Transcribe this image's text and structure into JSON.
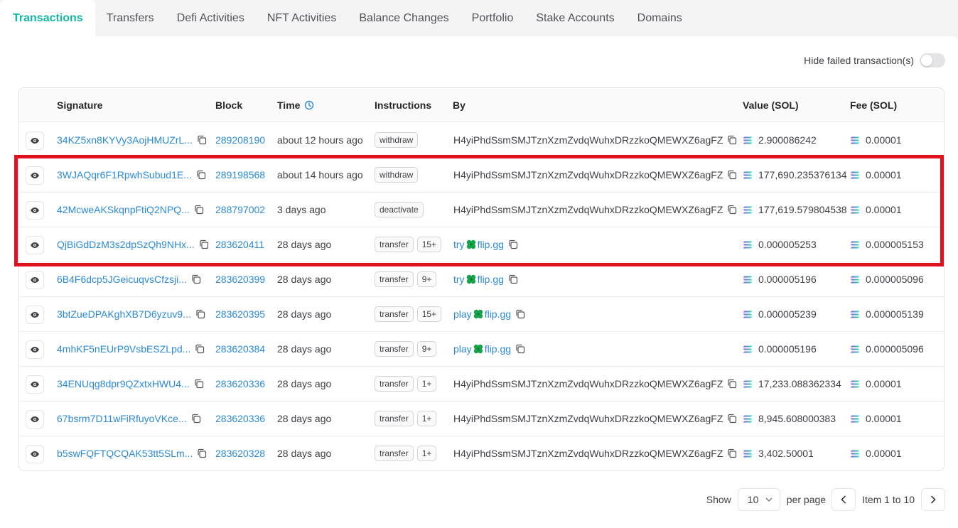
{
  "tabs": [
    {
      "label": "Transactions",
      "active": true
    },
    {
      "label": "Transfers"
    },
    {
      "label": "Defi Activities"
    },
    {
      "label": "NFT Activities"
    },
    {
      "label": "Balance Changes"
    },
    {
      "label": "Portfolio"
    },
    {
      "label": "Stake Accounts"
    },
    {
      "label": "Domains"
    }
  ],
  "toggle": {
    "label": "Hide failed transaction(s)",
    "on": false
  },
  "columns": {
    "signature": "Signature",
    "block": "Block",
    "time": "Time",
    "instructions": "Instructions",
    "by": "By",
    "value": "Value (SOL)",
    "fee": "Fee (SOL)"
  },
  "rows": [
    {
      "signature": "34KZ5xn8KYVy3AojHMUZrL...",
      "block": "289208190",
      "time": "about 12 hours ago",
      "instruction": "withdraw",
      "count": "",
      "by": "H4yiPhdSsmSMJTznXzmZvdqWuhxDRzzkoQMEWXZ6agFZ",
      "by_type": "address",
      "value": "2.900086242",
      "fee": "0.00001"
    },
    {
      "signature": "3WJAQqr6F1RpwhSubud1E...",
      "block": "289198568",
      "time": "about 14 hours ago",
      "instruction": "withdraw",
      "count": "",
      "by": "H4yiPhdSsmSMJTznXzmZvdqWuhxDRzzkoQMEWXZ6agFZ",
      "by_type": "address",
      "value": "177,690.235376134",
      "fee": "0.00001"
    },
    {
      "signature": "42McweAKSkqnpFtiQ2NPQ...",
      "block": "288797002",
      "time": "3 days ago",
      "instruction": "deactivate",
      "count": "",
      "by": "H4yiPhdSsmSMJTznXzmZvdqWuhxDRzzkoQMEWXZ6agFZ",
      "by_type": "address",
      "value": "177,619.579804538",
      "fee": "0.00001"
    },
    {
      "signature": "QjBiGdDzM3s2dpSzQh9NHx...",
      "block": "283620411",
      "time": "28 days ago",
      "instruction": "transfer",
      "count": "15+",
      "by_prefix": "try",
      "by_suffix": "flip.gg",
      "by_type": "domain",
      "value": "0.000005253",
      "fee": "0.000005153"
    },
    {
      "signature": "6B4F6dcp5JGeicuqvsCfzsji...",
      "block": "283620399",
      "time": "28 days ago",
      "instruction": "transfer",
      "count": "9+",
      "by_prefix": "try",
      "by_suffix": "flip.gg",
      "by_type": "domain",
      "value": "0.000005196",
      "fee": "0.000005096"
    },
    {
      "signature": "3btZueDPAKghXB7D6yzuv9...",
      "block": "283620395",
      "time": "28 days ago",
      "instruction": "transfer",
      "count": "15+",
      "by_prefix": "play",
      "by_suffix": "flip.gg",
      "by_type": "domain",
      "value": "0.000005239",
      "fee": "0.000005139"
    },
    {
      "signature": "4mhKF5nEUrP9VsbESZLpd...",
      "block": "283620384",
      "time": "28 days ago",
      "instruction": "transfer",
      "count": "9+",
      "by_prefix": "play",
      "by_suffix": "flip.gg",
      "by_type": "domain",
      "value": "0.000005196",
      "fee": "0.000005096"
    },
    {
      "signature": "34ENUqg8dpr9QZxtxHWU4...",
      "block": "283620336",
      "time": "28 days ago",
      "instruction": "transfer",
      "count": "1+",
      "by": "H4yiPhdSsmSMJTznXzmZvdqWuhxDRzzkoQMEWXZ6agFZ",
      "by_type": "address",
      "value": "17,233.088362334",
      "fee": "0.00001"
    },
    {
      "signature": "67bsrm7D11wFiRfuyoVKce...",
      "block": "283620336",
      "time": "28 days ago",
      "instruction": "transfer",
      "count": "1+",
      "by": "H4yiPhdSsmSMJTznXzmZvdqWuhxDRzzkoQMEWXZ6agFZ",
      "by_type": "address",
      "value": "8,945.608000383",
      "fee": "0.00001"
    },
    {
      "signature": "b5swFQFTQCQAK53tt5SLm...",
      "block": "283620328",
      "time": "28 days ago",
      "instruction": "transfer",
      "count": "1+",
      "by": "H4yiPhdSsmSMJTznXzmZvdqWuhxDRzzkoQMEWXZ6agFZ",
      "by_type": "address",
      "value": "3,402.50001",
      "fee": "0.00001"
    }
  ],
  "pagination": {
    "show_label": "Show",
    "per_page_value": "10",
    "per_page_label": "per page",
    "range_label": "Item 1 to 10"
  },
  "colors": {
    "accent": "#14b8a6",
    "link": "#2b8ad8",
    "highlight": "#e1121f"
  },
  "icons": {
    "row": "eye-icon",
    "copy": "copy-icon",
    "time": "clock-icon",
    "sol": "solana-icon",
    "domain": "clover-icon"
  }
}
